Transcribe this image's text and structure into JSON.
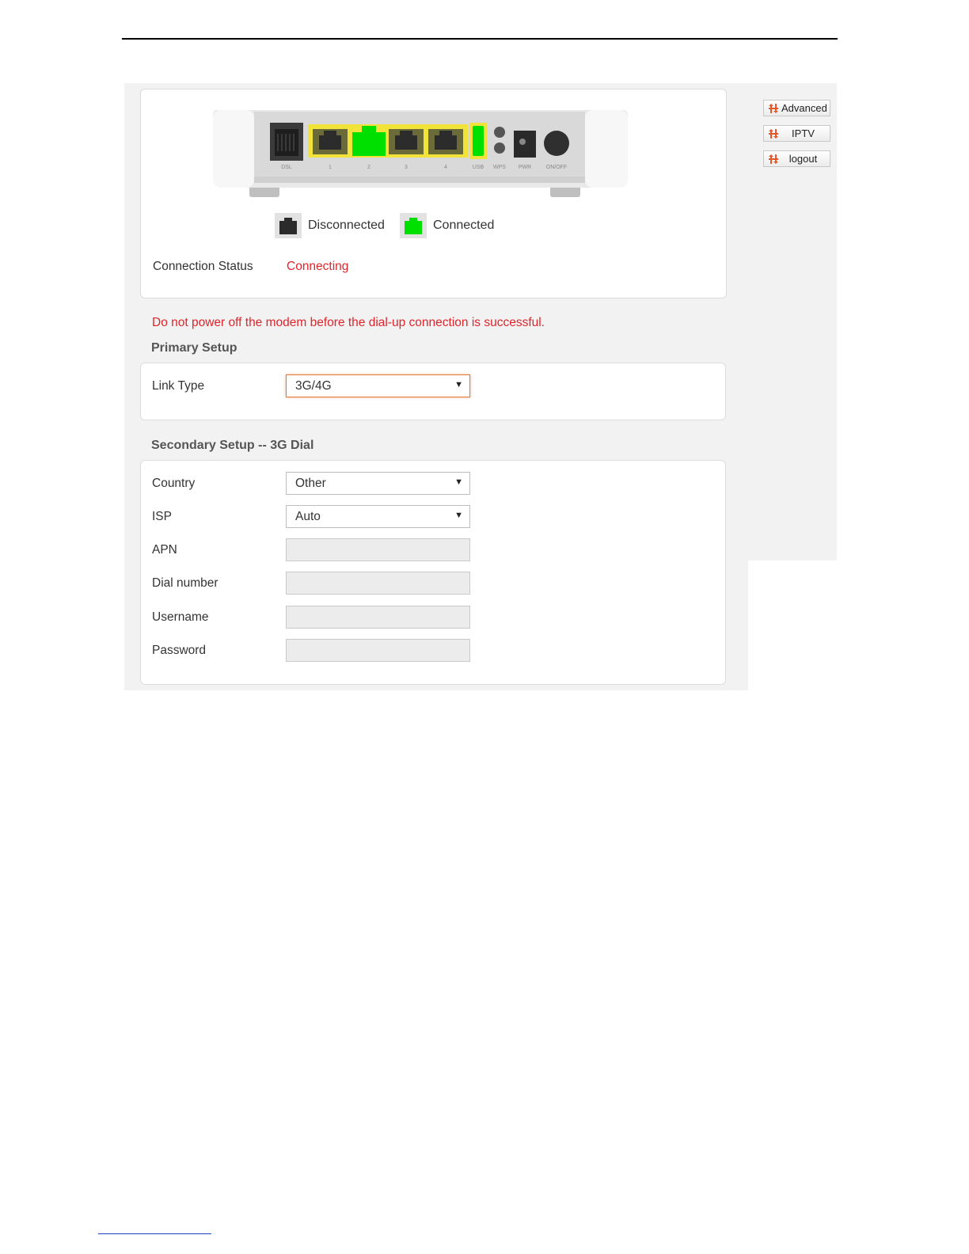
{
  "sidebar": {
    "buttons": [
      {
        "label": "Advanced"
      },
      {
        "label": "IPTV"
      },
      {
        "label": "logout"
      }
    ],
    "icon": "dual-arrow-icon",
    "icon_color": "#e8552a"
  },
  "router_image": {
    "ports": [
      {
        "id": "dsl",
        "label": "DSL",
        "state": "disconnected"
      },
      {
        "id": "lan1",
        "label": "1",
        "state": "disconnected"
      },
      {
        "id": "lan2",
        "label": "2",
        "state": "connected"
      },
      {
        "id": "lan3",
        "label": "3",
        "state": "disconnected"
      },
      {
        "id": "lan4",
        "label": "4",
        "state": "disconnected"
      },
      {
        "id": "usb",
        "label": "USB",
        "state": "connected"
      }
    ],
    "extra_labels": [
      "WPS",
      "PWR",
      "ON/OFF"
    ],
    "highlight_color": "#f2e33a",
    "connected_color": "#00e000"
  },
  "legend": {
    "disconnected": "Disconnected",
    "connected": "Connected"
  },
  "connection": {
    "label": "Connection Status",
    "value": "Connecting",
    "value_color": "#e0242b"
  },
  "warning": "Do not power off the modem before the dial-up connection is successful.",
  "primary": {
    "title": "Primary Setup",
    "link_type_label": "Link Type",
    "link_type_value": "3G/4G"
  },
  "secondary": {
    "title": "Secondary Setup -- 3G Dial",
    "country_label": "Country",
    "country_value": "Other",
    "isp_label": "ISP",
    "isp_value": "Auto",
    "apn_label": "APN",
    "apn_value": "",
    "dial_label": "Dial number",
    "dial_value": "",
    "username_label": "Username",
    "username_value": "",
    "password_label": "Password",
    "password_value": ""
  }
}
